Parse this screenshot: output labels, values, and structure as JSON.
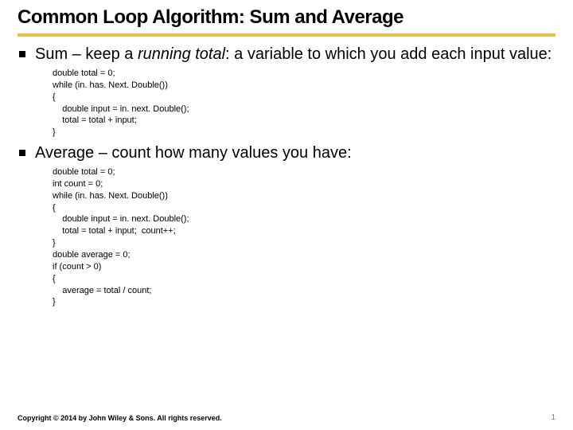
{
  "title": "Common Loop Algorithm: Sum and Average",
  "bullets": [
    {
      "pre": "Sum – keep a ",
      "ital": "running total",
      "post": ": a variable to which you add each input value:",
      "code": "double total = 0;\nwhile (in. has. Next. Double())\n{\n    double input = in. next. Double();\n    total = total + input;\n}"
    },
    {
      "pre": "Average – count how many values you have:",
      "ital": "",
      "post": "",
      "code": "double total = 0;\nint count = 0;\nwhile (in. has. Next. Double())\n{\n    double input = in. next. Double();\n    total = total + input;  count++;\n}\ndouble average = 0;\nif (count > 0)\n{\n    average = total / count;\n}"
    }
  ],
  "footer": {
    "copyright": "Copyright © 2014 by John Wiley & Sons. All rights reserved.",
    "page": "1"
  }
}
